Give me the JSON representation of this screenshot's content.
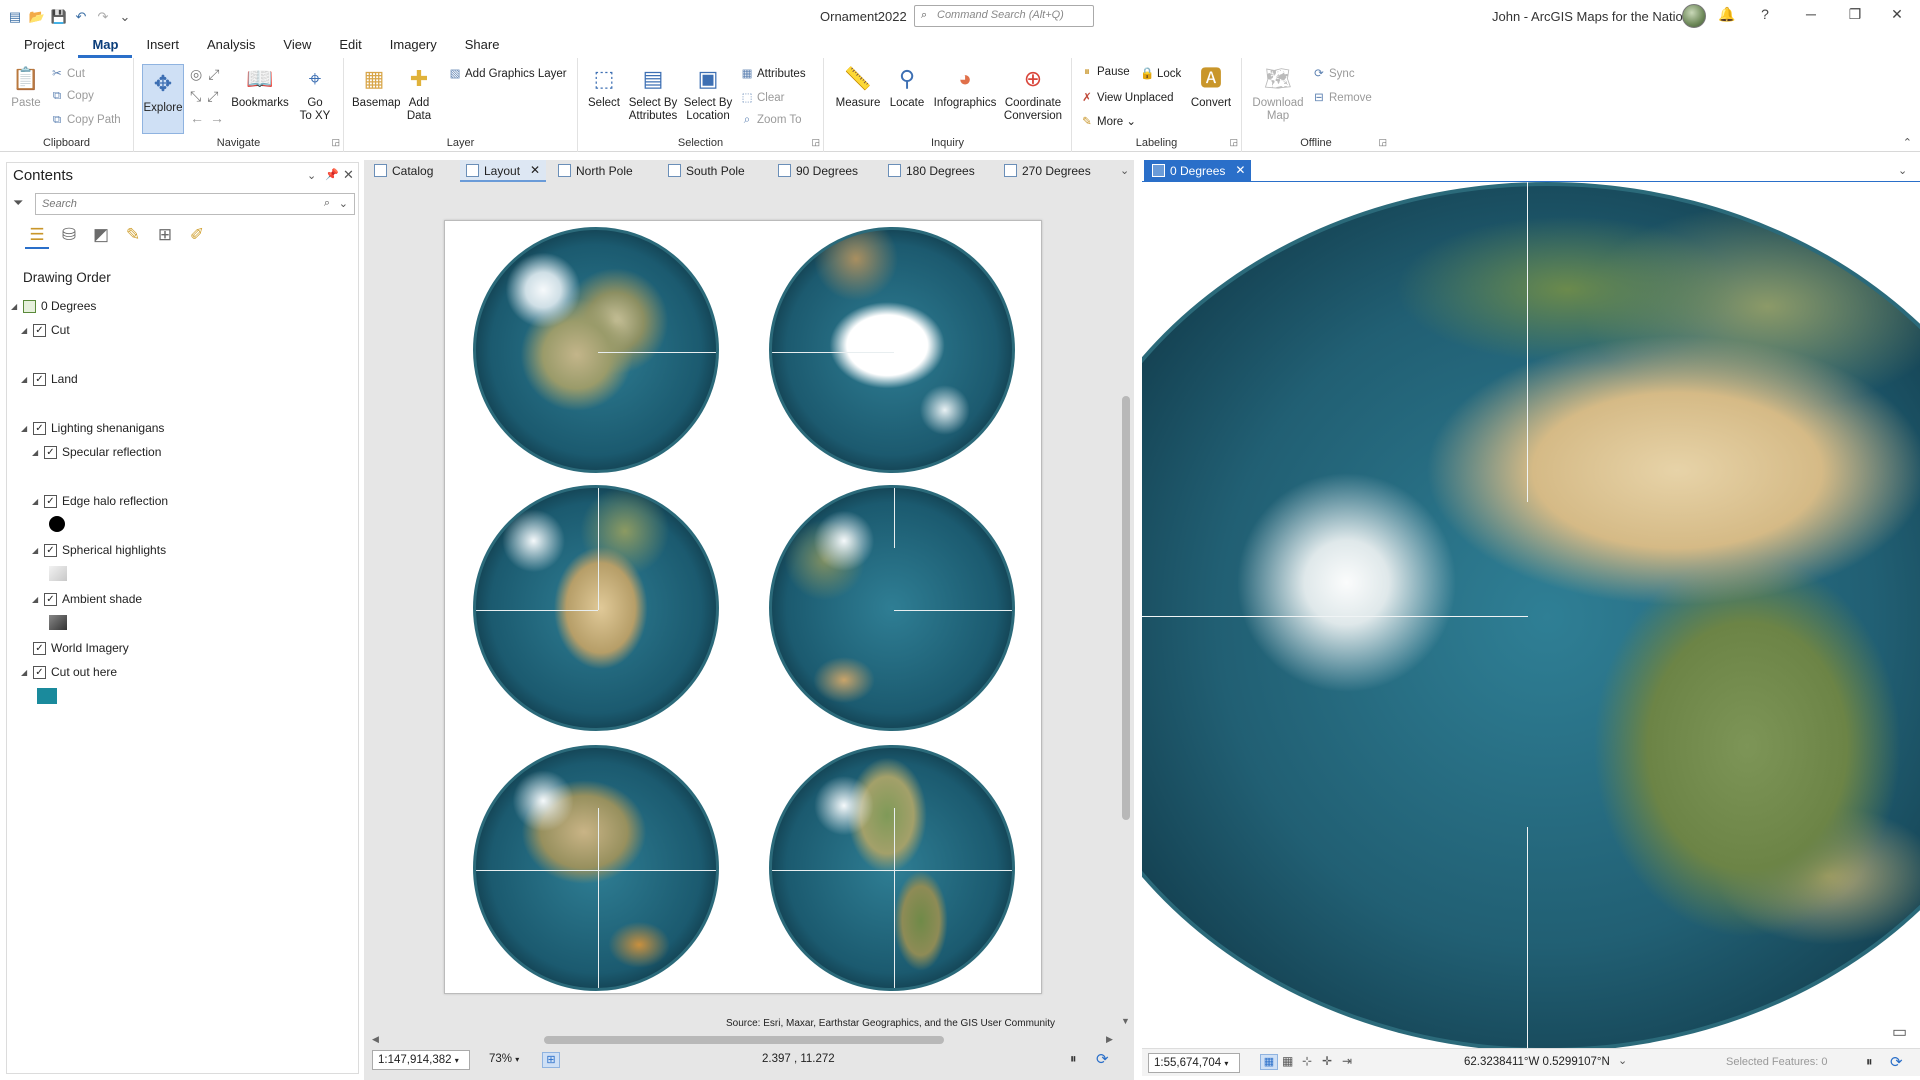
{
  "title_bar": {
    "document": "Ornament2022",
    "command_search_placeholder": "Command Search (Alt+Q)",
    "user": "John - ArcGIS Maps for the Nation",
    "help": "?"
  },
  "menu_tabs": [
    "Project",
    "Map",
    "Insert",
    "Analysis",
    "View",
    "Edit",
    "Imagery",
    "Share"
  ],
  "active_menu_tab": "Map",
  "ribbon": {
    "clipboard": {
      "title": "Clipboard",
      "paste": "Paste",
      "cut": "Cut",
      "copy": "Copy",
      "copy_path": "Copy Path"
    },
    "navigate": {
      "title": "Navigate",
      "explore": "Explore",
      "bookmarks": "Bookmarks",
      "go_to_xy_1": "Go",
      "go_to_xy_2": "To XY"
    },
    "layer": {
      "title": "Layer",
      "basemap": "Basemap",
      "add_data_1": "Add",
      "add_data_2": "Data",
      "add_graphics_layer": "Add Graphics Layer"
    },
    "selection": {
      "title": "Selection",
      "select": "Select",
      "select_by_attributes_1": "Select By",
      "select_by_attributes_2": "Attributes",
      "select_by_location_1": "Select By",
      "select_by_location_2": "Location",
      "attributes": "Attributes",
      "clear": "Clear",
      "zoom_to": "Zoom To"
    },
    "inquiry": {
      "title": "Inquiry",
      "measure": "Measure",
      "locate": "Locate",
      "infographics": "Infographics",
      "coordinate_conversion_1": "Coordinate",
      "coordinate_conversion_2": "Conversion"
    },
    "labeling": {
      "title": "Labeling",
      "pause": "Pause",
      "lock": "Lock",
      "view_unplaced": "View Unplaced",
      "more": "More",
      "convert": "Convert"
    },
    "offline": {
      "title": "Offline",
      "download_map_1": "Download",
      "download_map_2": "Map",
      "sync": "Sync",
      "remove": "Remove"
    }
  },
  "contents": {
    "title": "Contents",
    "search_placeholder": "Search",
    "drawing_order": "Drawing Order",
    "layers": {
      "map": "0 Degrees",
      "cut": "Cut",
      "land": "Land",
      "lighting": "Lighting shenanigans",
      "specular": "Specular reflection",
      "edge_halo": "Edge halo reflection",
      "spherical": "Spherical highlights",
      "ambient": "Ambient shade",
      "world_imagery": "World Imagery",
      "cut_out": "Cut out here"
    },
    "colors": {
      "edge_halo": "#000000",
      "spherical": "#d9d9d9",
      "ambient": "#555555",
      "cut_out": "#1a8a9c"
    }
  },
  "view_tabs": [
    "Catalog",
    "Layout",
    "North Pole",
    "South Pole",
    "90 Degrees",
    "180 Degrees",
    "270 Degrees"
  ],
  "active_view_tab": "Layout",
  "map_tab": "0 Degrees",
  "layout": {
    "source": "Source: Esri, Maxar, Earthstar Geographics, and the GIS User Community",
    "scale": "1:147,914,382",
    "zoom": "73%",
    "coords": "2.397 , 11.272"
  },
  "map_status": {
    "scale": "1:55,674,704",
    "coords": "62.3238411°W 0.5299107°N",
    "selected_features": "Selected Features: 0"
  }
}
